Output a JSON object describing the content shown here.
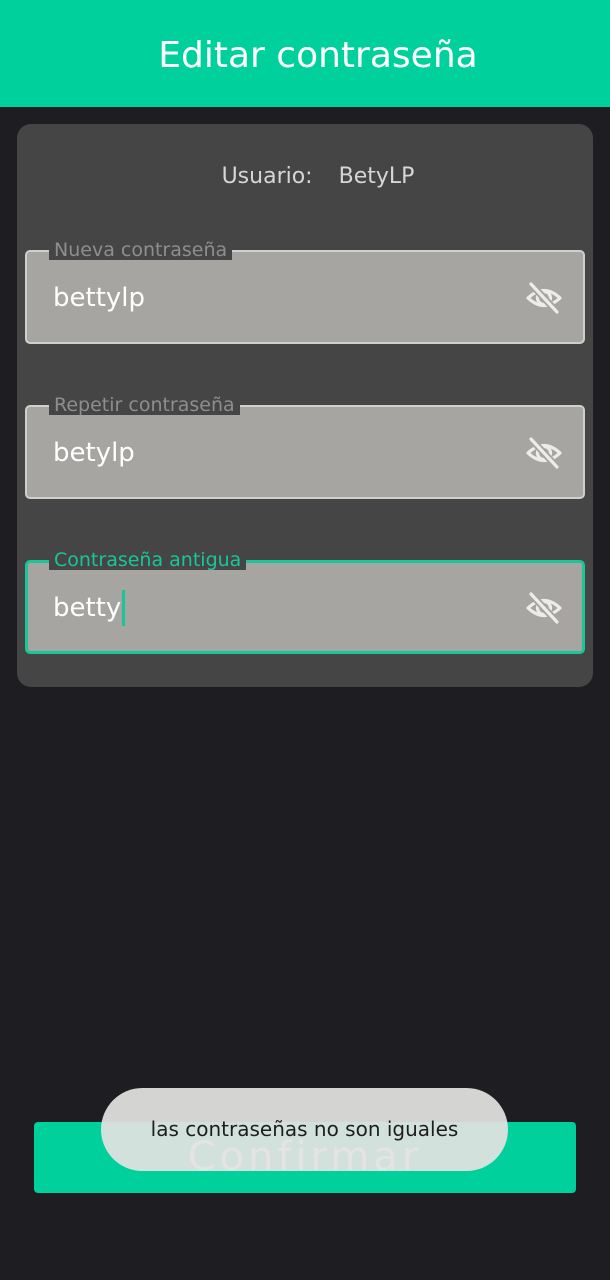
{
  "header": {
    "title": "Editar contraseña"
  },
  "user": {
    "label": "Usuario:",
    "value": "BetyLP"
  },
  "fields": [
    {
      "label": "Nueva contraseña",
      "value": "bettylp",
      "toggle_icon": "eye-off-icon"
    },
    {
      "label": "Repetir contraseña",
      "value": "betylp",
      "toggle_icon": "eye-off-icon"
    },
    {
      "label": "Contraseña antigua",
      "value": "betty",
      "toggle_icon": "eye-off-icon",
      "focused": true
    }
  ],
  "actions": {
    "confirm_label": "Confirmar"
  },
  "toast": {
    "message": "las contraseñas no son iguales"
  },
  "colors": {
    "accent": "#00d09c",
    "focus": "#19c698",
    "background": "#1e1d22",
    "card": "#454545",
    "field": "#a6a5a1"
  }
}
